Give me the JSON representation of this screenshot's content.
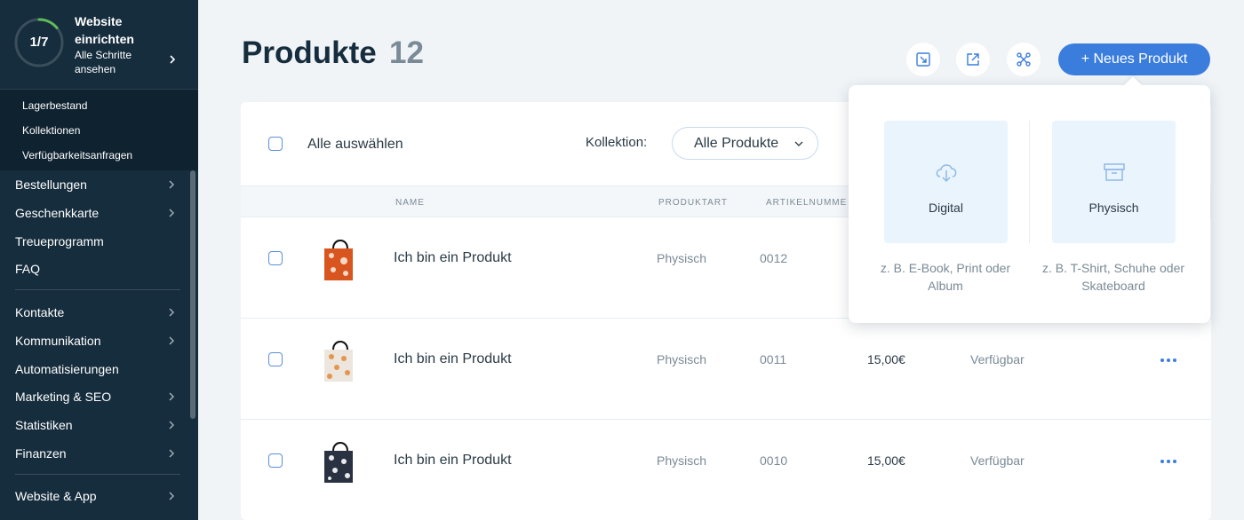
{
  "sidebar": {
    "setup": {
      "progress": "1/7",
      "progress_fraction": 0.14,
      "title": "Website einrichten",
      "subtitle": "Alle Schritte ansehen"
    },
    "subnav": [
      "Lagerbestand",
      "Kollektionen",
      "Verfügbarkeitsanfragen"
    ],
    "items": [
      {
        "label": "Bestellungen",
        "chevron": true
      },
      {
        "label": "Geschenkkarte",
        "chevron": true
      },
      {
        "label": "Treueprogramm",
        "chevron": false
      },
      {
        "label": "FAQ",
        "chevron": false
      },
      {
        "label": "Kontakte",
        "chevron": true
      },
      {
        "label": "Kommunikation",
        "chevron": true
      },
      {
        "label": "Automatisierungen",
        "chevron": false
      },
      {
        "label": "Marketing & SEO",
        "chevron": true
      },
      {
        "label": "Statistiken",
        "chevron": true
      },
      {
        "label": "Finanzen",
        "chevron": true
      },
      {
        "label": "Website & App",
        "chevron": true
      }
    ]
  },
  "header": {
    "title": "Produkte",
    "count": "12",
    "icons": [
      "import-icon",
      "export-icon",
      "connect-icon"
    ],
    "new_button": "+ Neues Produkt"
  },
  "toolbar": {
    "select_all": "Alle auswählen",
    "collection_label": "Kollektion:",
    "collection_value": "Alle Produkte"
  },
  "table": {
    "columns": [
      "NAME",
      "PRODUKTART",
      "ARTIKELNUMME"
    ],
    "rows": [
      {
        "name": "Ich bin ein Produkt",
        "type": "Physisch",
        "sku": "0012",
        "price": "",
        "status": "",
        "bag": "orange"
      },
      {
        "name": "Ich bin ein Produkt",
        "type": "Physisch",
        "sku": "0011",
        "price": "15,00€",
        "status": "Verfügbar",
        "bag": "dots"
      },
      {
        "name": "Ich bin ein Produkt",
        "type": "Physisch",
        "sku": "0010",
        "price": "15,00€",
        "status": "Verfügbar",
        "bag": "dark"
      }
    ]
  },
  "popover": {
    "digital": {
      "label": "Digital",
      "desc": "z. B. E-Book, Print oder Album",
      "icon": "cloud-download-icon"
    },
    "physical": {
      "label": "Physisch",
      "desc": "z. B. T-Shirt, Schuhe oder Skateboard",
      "icon": "box-icon"
    }
  },
  "colors": {
    "sidebar": "#162d3d",
    "accent": "#3b7ddd",
    "tile": "#eaf4fd",
    "text_dark": "#162d3d",
    "text_muted": "#7a8a96"
  }
}
